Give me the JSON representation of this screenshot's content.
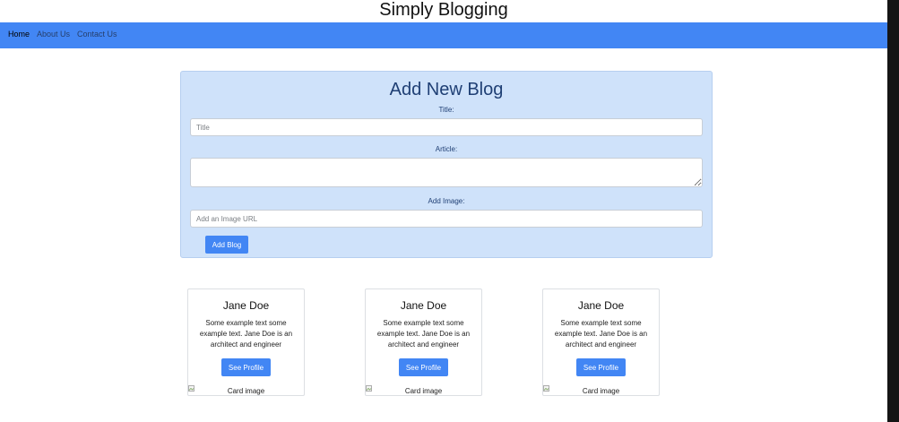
{
  "site": {
    "title": "Simply Blogging"
  },
  "nav": {
    "items": [
      {
        "label": "Home"
      },
      {
        "label": "About Us"
      },
      {
        "label": "Contact Us"
      }
    ]
  },
  "form": {
    "heading": "Add New Blog",
    "title_label": "Title:",
    "title_placeholder": "Title",
    "article_label": "Article:",
    "image_label": "Add Image:",
    "image_placeholder": "Add an Image URL",
    "submit_label": "Add Blog"
  },
  "cards": [
    {
      "name": "Jane Doe",
      "text": "Some example text some example text. Jane Doe is an architect and engineer",
      "button_label": "See Profile",
      "image_alt": "Card image",
      "image_icon": "broken-image-icon"
    },
    {
      "name": "Jane Doe",
      "text": "Some example text some example text. Jane Doe is an architect and engineer",
      "button_label": "See Profile",
      "image_alt": "Card image",
      "image_icon": "broken-image-icon"
    },
    {
      "name": "Jane Doe",
      "text": "Some example text some example text. Jane Doe is an architect and engineer",
      "button_label": "See Profile",
      "image_alt": "Card image",
      "image_icon": "broken-image-icon"
    }
  ],
  "colors": {
    "navbar": "#4286f4",
    "panel": "#cfe2fa",
    "heading": "#1f3f74",
    "button": "#4286f4"
  }
}
